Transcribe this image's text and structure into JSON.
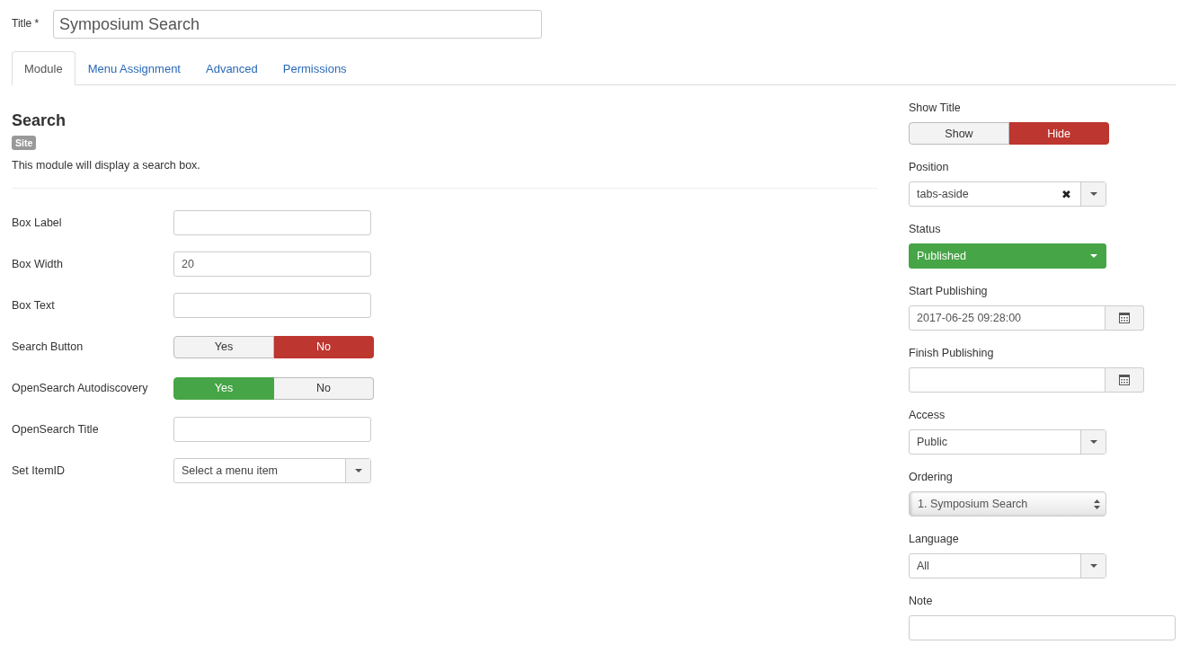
{
  "title_field": {
    "label": "Title *",
    "value": "Symposium Search"
  },
  "tabs": [
    {
      "label": "Module",
      "selected": true
    },
    {
      "label": "Menu Assignment",
      "selected": false
    },
    {
      "label": "Advanced",
      "selected": false
    },
    {
      "label": "Permissions",
      "selected": false
    }
  ],
  "module": {
    "heading": "Search",
    "badge": "Site",
    "description": "This module will display a search box."
  },
  "fields": [
    {
      "kind": "text",
      "label": "Box Label"
    },
    {
      "kind": "text",
      "label": "Box Width",
      "value": "20"
    },
    {
      "kind": "text",
      "label": "Box Text"
    },
    {
      "kind": "toggle",
      "label": "Search Button",
      "options": [
        {
          "label": "Yes",
          "selected": false
        },
        {
          "label": "No",
          "selected": true,
          "color": "#bd362f"
        }
      ]
    },
    {
      "kind": "toggle",
      "label": "OpenSearch Autodiscovery",
      "options": [
        {
          "label": "Yes",
          "selected": true,
          "color": "#46a546"
        },
        {
          "label": "No",
          "selected": false
        }
      ]
    },
    {
      "kind": "text",
      "label": "OpenSearch Title"
    },
    {
      "kind": "select",
      "label": "Set ItemID",
      "value": "Select a menu item"
    }
  ],
  "sidebar": [
    {
      "kind": "toggle",
      "label": "Show Title",
      "options": [
        {
          "label": "Show",
          "selected": false
        },
        {
          "label": "Hide",
          "selected": true,
          "color": "#bd362f"
        }
      ]
    },
    {
      "kind": "clearable",
      "label": "Position",
      "value": "tabs-aside",
      "clear": "✖"
    },
    {
      "kind": "select",
      "label": "Status",
      "value": "Published",
      "color": "#46a546"
    },
    {
      "kind": "date",
      "label": "Start Publishing",
      "value": "2017-06-25 09:28:00"
    },
    {
      "kind": "date",
      "label": "Finish Publishing"
    },
    {
      "kind": "select",
      "label": "Access",
      "value": "Public"
    },
    {
      "kind": "ordering",
      "label": "Ordering",
      "value": "1. Symposium Search"
    },
    {
      "kind": "select",
      "label": "Language",
      "value": "All"
    },
    {
      "kind": "wide",
      "label": "Note"
    }
  ]
}
